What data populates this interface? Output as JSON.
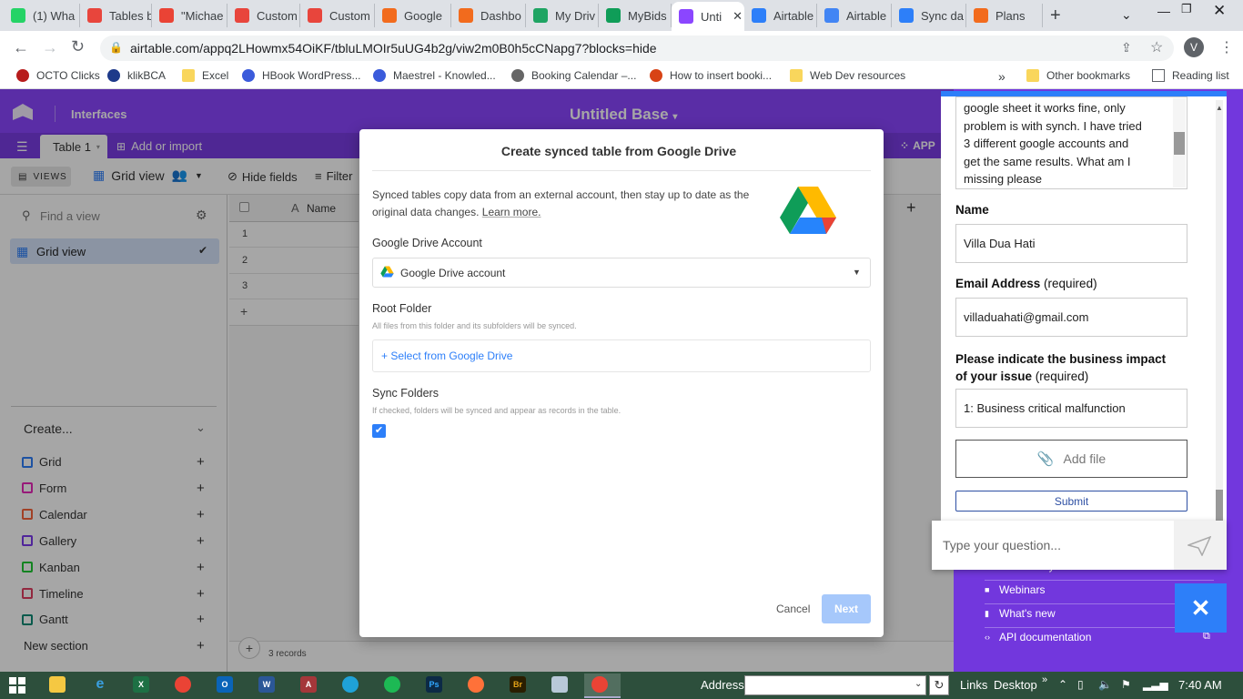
{
  "browser": {
    "tabs": [
      {
        "label": "(1) Wha",
        "icon": "whatsapp-icon",
        "color": "#25d366"
      },
      {
        "label": "Tables b",
        "icon": "heart-icon",
        "color": "#e8453c"
      },
      {
        "label": "\"Michae",
        "icon": "gmail-icon",
        "color": "#ea4335"
      },
      {
        "label": "Custom",
        "icon": "heart-icon",
        "color": "#e8453c"
      },
      {
        "label": "Custom",
        "icon": "heart-icon",
        "color": "#e8453c"
      },
      {
        "label": "Google",
        "icon": "gear-icon",
        "color": "#f26b1d"
      },
      {
        "label": "Dashbo",
        "icon": "gear-icon",
        "color": "#f26b1d"
      },
      {
        "label": "My Driv",
        "icon": "drive-icon",
        "color": "#1fa463"
      },
      {
        "label": "MyBids",
        "icon": "sheets-icon",
        "color": "#0f9d58"
      },
      {
        "label": "Unti",
        "icon": "airtable-icon",
        "color": "#8b46ff",
        "active": true
      },
      {
        "label": "Airtable",
        "icon": "airtable-icon",
        "color": "#2d7ff9"
      },
      {
        "label": "Airtable",
        "icon": "google-icon",
        "color": "#4285f4"
      },
      {
        "label": "Sync da",
        "icon": "airtable-icon",
        "color": "#2d7ff9"
      },
      {
        "label": "Plans",
        "icon": "gear-icon",
        "color": "#f26b1d"
      }
    ],
    "url": "airtable.com/appq2LHowmx54OiKF/tbluLMOIr5uUG4b2g/viw2m0B0h5cCNapg7?blocks=hide",
    "profile_initial": "V",
    "bookmarks": [
      "OCTO Clicks",
      "klikBCA",
      "Excel",
      "HBook WordPress...",
      "Maestrel - Knowled...",
      "Booking Calendar –...",
      "How to insert booki...",
      "Web Dev resources"
    ],
    "other_bookmarks": "Other bookmarks",
    "reading_list": "Reading list",
    "more": "»"
  },
  "airtable": {
    "interfaces": "Interfaces",
    "base_title": "Untitled Base",
    "table_tab": "Table 1",
    "add_import": "Add or import",
    "views_label": "VIEWS",
    "view_name": "Grid view",
    "hide_fields": "Hide fields",
    "filter": "Filter",
    "apps_fragment": "S",
    "apps_label": "APP",
    "find_view": "Find a view",
    "sidebar_view": "Grid view",
    "create_label": "Create...",
    "create_items": [
      {
        "label": "Grid",
        "color": "#2d7ff9"
      },
      {
        "label": "Form",
        "color": "#e929ba"
      },
      {
        "label": "Calendar",
        "color": "#f7653b"
      },
      {
        "label": "Gallery",
        "color": "#7c39ed"
      },
      {
        "label": "Kanban",
        "color": "#20c933"
      },
      {
        "label": "Timeline",
        "color": "#e03e62"
      },
      {
        "label": "Gantt",
        "color": "#0d8a75"
      }
    ],
    "new_section": "New section",
    "column_name": "Name",
    "rows": [
      "1",
      "2",
      "3"
    ],
    "records": "3 records"
  },
  "modal": {
    "title": "Create synced table from Google Drive",
    "description": "Synced tables copy data from an external account, then stay up to date as the original data changes.",
    "learn_more": "Learn more.",
    "account_label": "Google Drive Account",
    "account_value": "Google Drive account",
    "root_label": "Root Folder",
    "root_hint": "All files from this folder and its subfolders will be synced.",
    "select_drive": "+ Select from Google Drive",
    "sync_label": "Sync Folders",
    "sync_hint": "If checked, folders will be synced and appear as records in the table.",
    "sync_checked": true,
    "cancel": "Cancel",
    "next": "Next"
  },
  "help": {
    "message_lines": [
      "google sheet it works fine, only",
      "problem is with synch. I have tried",
      "3 different google accounts and",
      "get the same results. What am I",
      "missing please"
    ],
    "name_label": "Name",
    "name_value": "Villa Dua Hati",
    "email_label": "Email Address",
    "email_required": " (required)",
    "email_value": "villaduahati@gmail.com",
    "impact_label_1": "Please indicate the business impact",
    "impact_label_2": "of your issue",
    "impact_required": " (required)",
    "impact_value": "1: Business critical malfunction",
    "add_file": "Add file",
    "submit": "Submit",
    "question_placeholder": "Type your question...",
    "links": [
      "Community",
      "Webinars",
      "What's new",
      "API documentation"
    ]
  },
  "taskbar": {
    "address_label": "Address",
    "links": "Links",
    "desktop": "Desktop",
    "time": "7:40 AM"
  }
}
